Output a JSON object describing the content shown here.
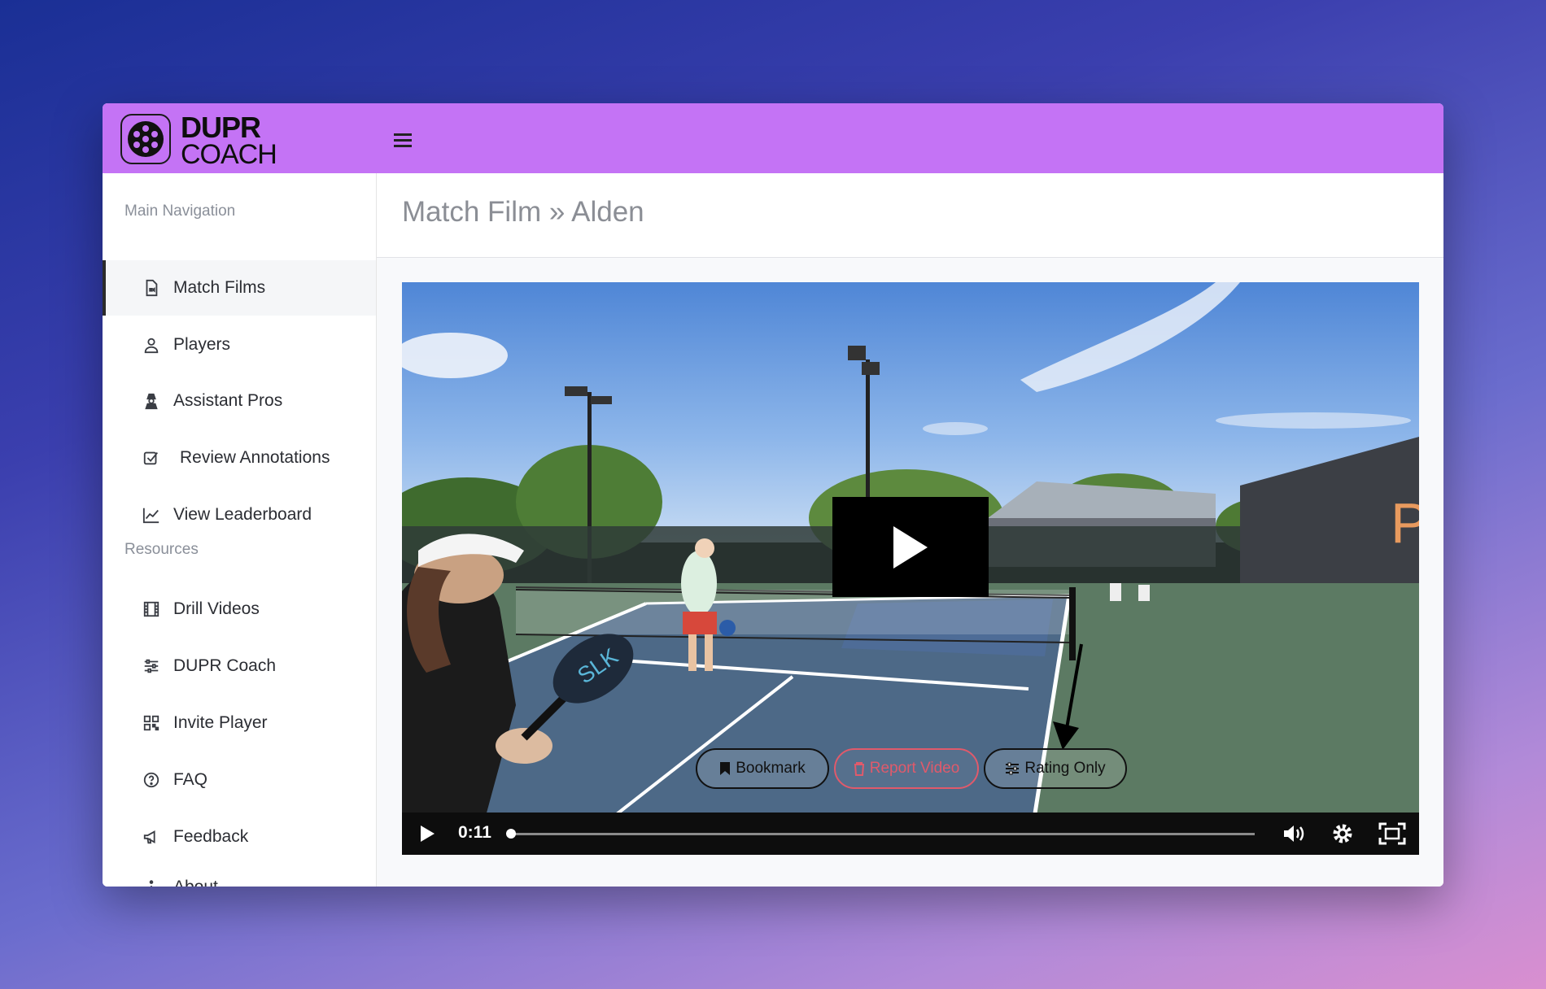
{
  "brand": {
    "line1": "DUPR",
    "line2": "COACH"
  },
  "header": {
    "menu_icon": "hamburger-icon"
  },
  "sidebar": {
    "section_main": "Main Navigation",
    "section_resources": "Resources",
    "main_items": [
      {
        "label": "Match Films",
        "icon": "video-file-icon",
        "active": true
      },
      {
        "label": "Players",
        "icon": "user-icon"
      },
      {
        "label": "Assistant Pros",
        "icon": "user-secret-icon"
      },
      {
        "label": "Review Annotations",
        "icon": "checkbox-icon"
      },
      {
        "label": "View Leaderboard",
        "icon": "chart-line-icon"
      }
    ],
    "resource_items": [
      {
        "label": "Drill Videos",
        "icon": "film-icon"
      },
      {
        "label": "DUPR Coach",
        "icon": "sliders-icon"
      },
      {
        "label": "Invite Player",
        "icon": "qr-code-icon"
      },
      {
        "label": "FAQ",
        "icon": "question-circle-icon"
      },
      {
        "label": "Feedback",
        "icon": "megaphone-icon"
      },
      {
        "label": "About",
        "icon": "info-icon"
      }
    ]
  },
  "page": {
    "breadcrumb_root": "Match Film",
    "separator": "»",
    "breadcrumb_current": "Alden"
  },
  "video": {
    "time": "0:11",
    "progress": 0.0,
    "buttons": {
      "bookmark": "Bookmark",
      "report": "Report Video",
      "rating": "Rating Only"
    }
  },
  "colors": {
    "topbar": "#c473f5",
    "report": "#e05a6b"
  }
}
